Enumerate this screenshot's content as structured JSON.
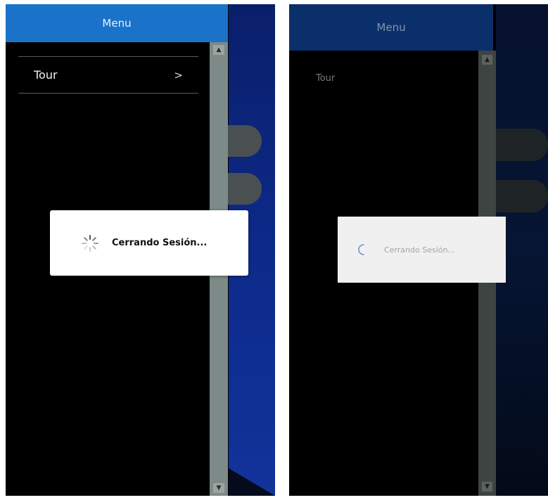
{
  "left_panel": {
    "header_title": "Menu",
    "menu_items": [
      {
        "label": "Tour",
        "chevron": ">"
      }
    ],
    "dialog_message": "Cerrando Sesión...",
    "accent_color": "#1a73c9"
  },
  "right_panel": {
    "header_title": "Menu",
    "menu_items": [
      {
        "label": "Tour"
      }
    ],
    "dialog_message": "Cerrando Sesión...",
    "accent_color": "#0b2f6a"
  }
}
